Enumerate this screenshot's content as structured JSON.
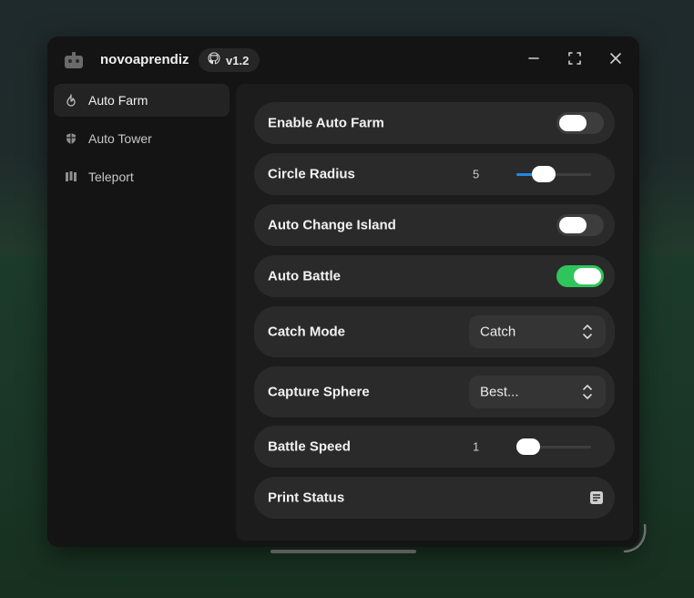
{
  "window": {
    "title": "novoaprendiz",
    "version": "v1.2"
  },
  "sidebar": {
    "items": [
      {
        "label": "Auto Farm",
        "icon": "flame-icon",
        "active": true
      },
      {
        "label": "Auto Tower",
        "icon": "shield-icon",
        "active": false
      },
      {
        "label": "Teleport",
        "icon": "map-icon",
        "active": false
      }
    ]
  },
  "settings": {
    "enable_auto_farm": {
      "label": "Enable Auto Farm",
      "enabled": false
    },
    "circle_radius": {
      "label": "Circle Radius",
      "value": "5",
      "fraction": 0.3
    },
    "auto_change_island": {
      "label": "Auto Change Island",
      "enabled": false
    },
    "auto_battle": {
      "label": "Auto Battle",
      "enabled": true
    },
    "catch_mode": {
      "label": "Catch Mode",
      "value": "Catch"
    },
    "capture_sphere": {
      "label": "Capture Sphere",
      "value": "Best..."
    },
    "battle_speed": {
      "label": "Battle Speed",
      "value": "1",
      "fraction": 0.0
    },
    "print_status": {
      "label": "Print Status"
    }
  },
  "colors": {
    "accent_toggle_on": "#2fc55a",
    "accent_slider": "#1e88e5",
    "window_bg": "#141414",
    "row_bg": "#2a2a2a"
  }
}
